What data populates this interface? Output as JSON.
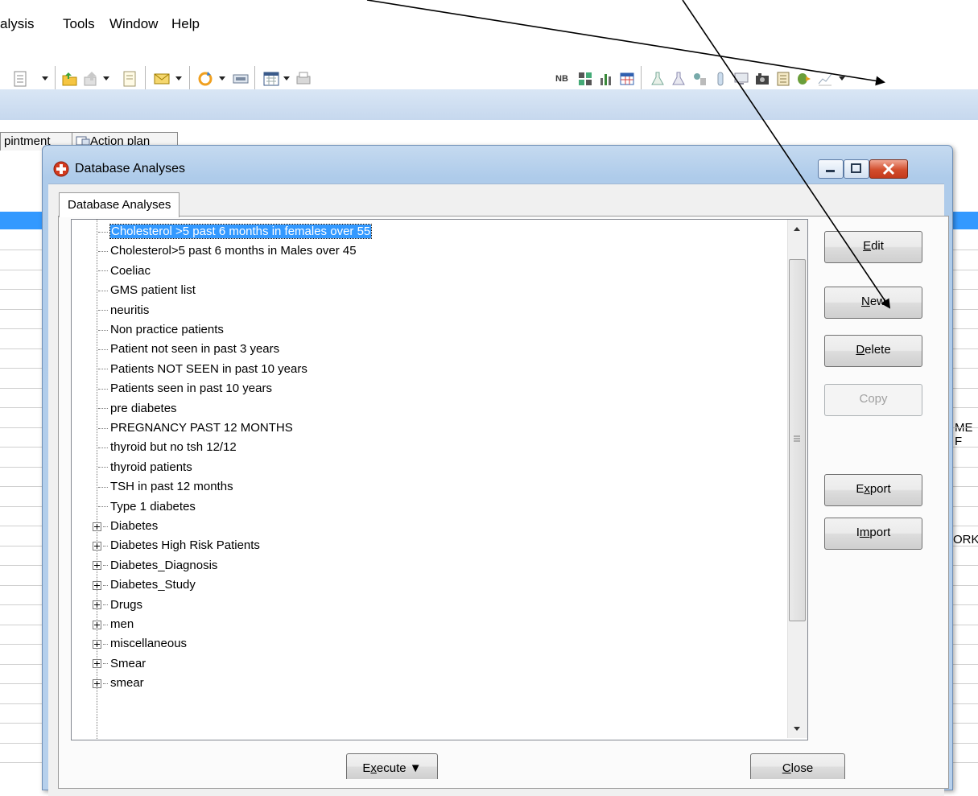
{
  "menubar": {
    "items": [
      "alysis",
      "Tools",
      "Window",
      "Help"
    ]
  },
  "toolbar": {
    "nb_label": "NB"
  },
  "background": {
    "tabs": [
      "pintment",
      "Action plan"
    ],
    "fragments": [
      "ME F",
      "ORK"
    ]
  },
  "dialog": {
    "title": "Database Analyses",
    "tab_label": "Database Analyses",
    "tree_items": [
      "Cholesterol >5 past 6 months in females over 55",
      "Cholesterol>5 past 6 months in Males over 45",
      "Coeliac",
      "GMS patient list",
      "neuritis",
      "Non practice patients",
      "Patient not seen in past 3 years",
      "Patients NOT SEEN in past 10 years",
      "Patients seen in past 10 years",
      "pre diabetes",
      "PREGNANCY PAST 12 MONTHS",
      "thyroid but no tsh 12/12",
      "thyroid patients",
      "TSH in past 12 months",
      "Type 1 diabetes"
    ],
    "tree_folders": [
      "Diabetes",
      "Diabetes High Risk Patients",
      "Diabetes_Diagnosis",
      "Diabetes_Study",
      "Drugs",
      "men",
      "miscellaneous",
      "Smear",
      "smear"
    ],
    "selected_index": 0,
    "buttons": {
      "edit": "Edit",
      "new": "New",
      "delete": "Delete",
      "copy": "Copy",
      "export": "Export",
      "import": "Import",
      "execute": "Execute ▼",
      "close": "Close"
    }
  },
  "colors": {
    "selection": "#3399ff",
    "title_gradient_top": "#c5daf0",
    "close_red": "#d24d2c"
  },
  "icons": [
    "folder-open-icon",
    "export-icon",
    "list-icon",
    "email-icon",
    "refresh-icon",
    "window-icon",
    "calendar-icon",
    "printer-icon",
    "database-icon",
    "expand-icon"
  ]
}
